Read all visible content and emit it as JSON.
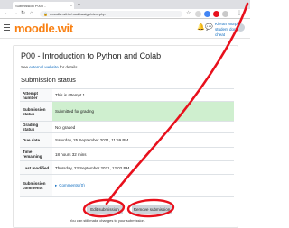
{
  "browser": {
    "tab_title": "Submission P000 -",
    "url": "moodle.wit.ie/mod/assign/view.php"
  },
  "header": {
    "logo_text": "moodle",
    "logo_suffix": ".wit",
    "user_name": "Kieran Murphy",
    "user_role": "student dont cheat"
  },
  "page": {
    "title": "P00 - Introduction to Python and Colab",
    "see_prefix": "See ",
    "see_link": "external website",
    "see_suffix": " for details.",
    "submission_heading": "Submission status"
  },
  "status_table": {
    "attempt_label": "Attempt number",
    "attempt_value": "This is attempt 1.",
    "submission_label": "Submission status",
    "submission_value": "Submitted for grading",
    "grading_label": "Grading status",
    "grading_value": "Not graded",
    "due_label": "Due date",
    "due_value": "Saturday, 25 September 2021, 11:59 PM",
    "remaining_label": "Time remaining",
    "remaining_value": "18 hours 32 mins",
    "modified_label": "Last modified",
    "modified_value": "Thursday, 23 September 2021, 12:02 PM",
    "comments_label": "Submission comments",
    "comments_value": "Comments (0)"
  },
  "actions": {
    "edit_label": "Edit submission",
    "remove_label": "Remove submission",
    "help_text": "You can still make changes to your submission."
  },
  "colors": {
    "moodle_orange": "#f98012",
    "link_blue": "#0f6cbf",
    "submitted_green": "#cfefcf",
    "annotation_red": "#e8101c"
  },
  "icons": [
    "back-icon",
    "forward-icon",
    "reload-icon",
    "lock-icon",
    "star-icon",
    "menu-icon",
    "bell-icon",
    "chat-icon",
    "expand-icon"
  ]
}
